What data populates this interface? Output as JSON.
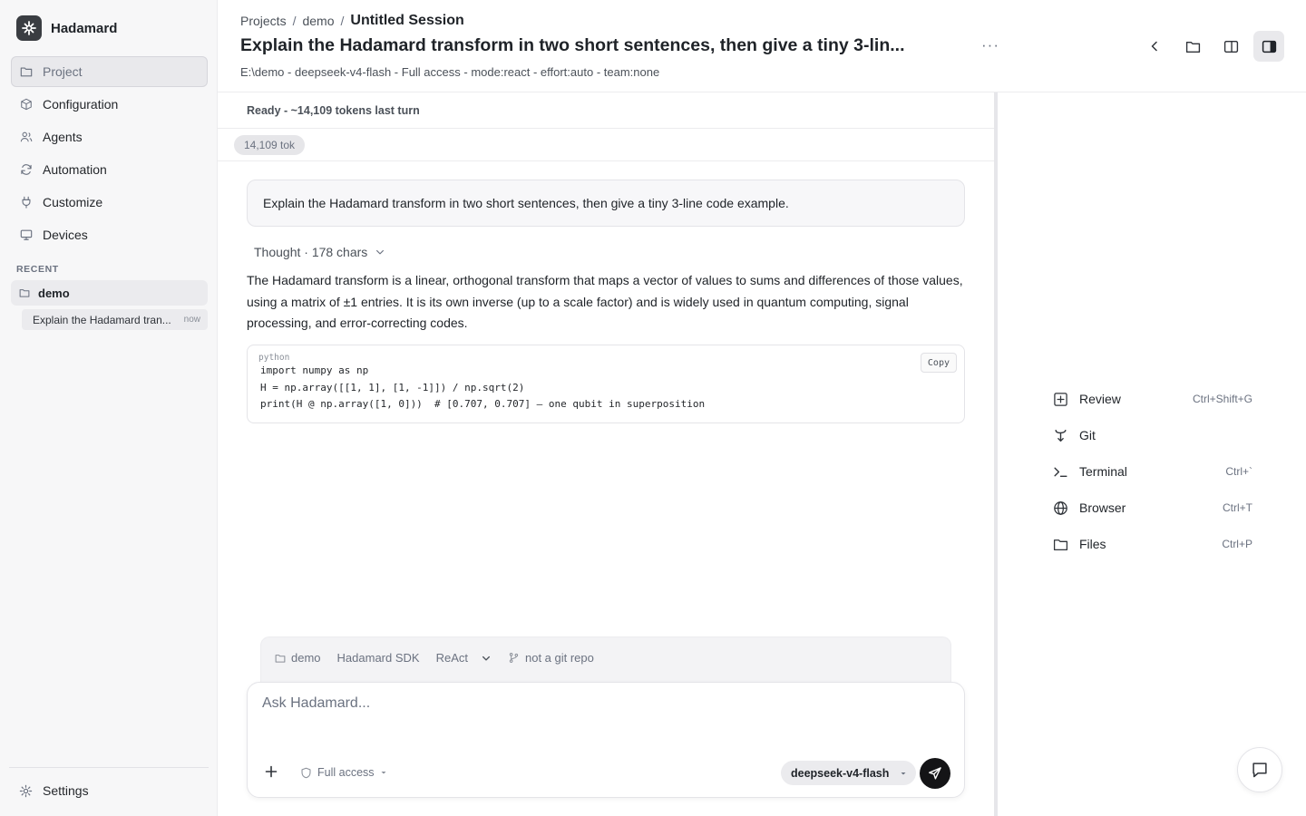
{
  "app": {
    "name": "Hadamard"
  },
  "sidebar": {
    "items": [
      {
        "label": "Project",
        "icon": "folder-icon",
        "active": true
      },
      {
        "label": "Configuration",
        "icon": "cube-icon"
      },
      {
        "label": "Agents",
        "icon": "users-icon"
      },
      {
        "label": "Automation",
        "icon": "refresh-icon"
      },
      {
        "label": "Customize",
        "icon": "plug-icon"
      },
      {
        "label": "Devices",
        "icon": "monitor-icon"
      }
    ],
    "recent_label": "RECENT",
    "recent_group": "demo",
    "recent_item": {
      "label": "Explain the Hadamard tran...",
      "time": "now"
    },
    "settings_label": "Settings"
  },
  "header": {
    "breadcrumb": {
      "projects": "Projects",
      "sep": "/",
      "project": "demo",
      "current": "Untitled Session"
    },
    "title": "Explain the Hadamard transform in two short sentences, then give a tiny 3-lin...",
    "more": "···",
    "meta": "E:\\demo - deepseek-v4-flash - Full access - mode:react - effort:auto - team:none"
  },
  "chat": {
    "status": "Ready - ~14,109 tokens last turn",
    "tokens_pill": "14,109 tok",
    "user_message": "Explain the Hadamard transform in two short sentences, then give a tiny 3-line code example.",
    "thought": "Thought · 178 chars",
    "answer": "The Hadamard transform is a linear, orthogonal transform that maps a vector of values to sums and differences of those values, using a matrix of ±1 entries. It is its own inverse (up to a scale factor) and is widely used in quantum computing, signal processing, and error-correcting codes.",
    "code": {
      "lang": "python",
      "copy_label": "Copy",
      "lines": "import numpy as np\nH = np.array([[1, 1], [1, -1]]) / np.sqrt(2)\nprint(H @ np.array([1, 0]))  # [0.707, 0.707] — one qubit in superposition"
    }
  },
  "composer": {
    "context": {
      "folder": "demo",
      "sdk": "Hadamard SDK",
      "mode": "ReAct",
      "git": "not a git repo"
    },
    "placeholder": "Ask Hadamard...",
    "access": "Full access",
    "model": "deepseek-v4-flash"
  },
  "panel": {
    "items": [
      {
        "label": "Review",
        "shortcut": "Ctrl+Shift+G",
        "icon": "plus-square-icon"
      },
      {
        "label": "Git",
        "shortcut": "",
        "icon": "git-branch-icon"
      },
      {
        "label": "Terminal",
        "shortcut": "Ctrl+`",
        "icon": "terminal-icon"
      },
      {
        "label": "Browser",
        "shortcut": "Ctrl+T",
        "icon": "globe-icon"
      },
      {
        "label": "Files",
        "shortcut": "Ctrl+P",
        "icon": "folder-icon"
      }
    ]
  }
}
